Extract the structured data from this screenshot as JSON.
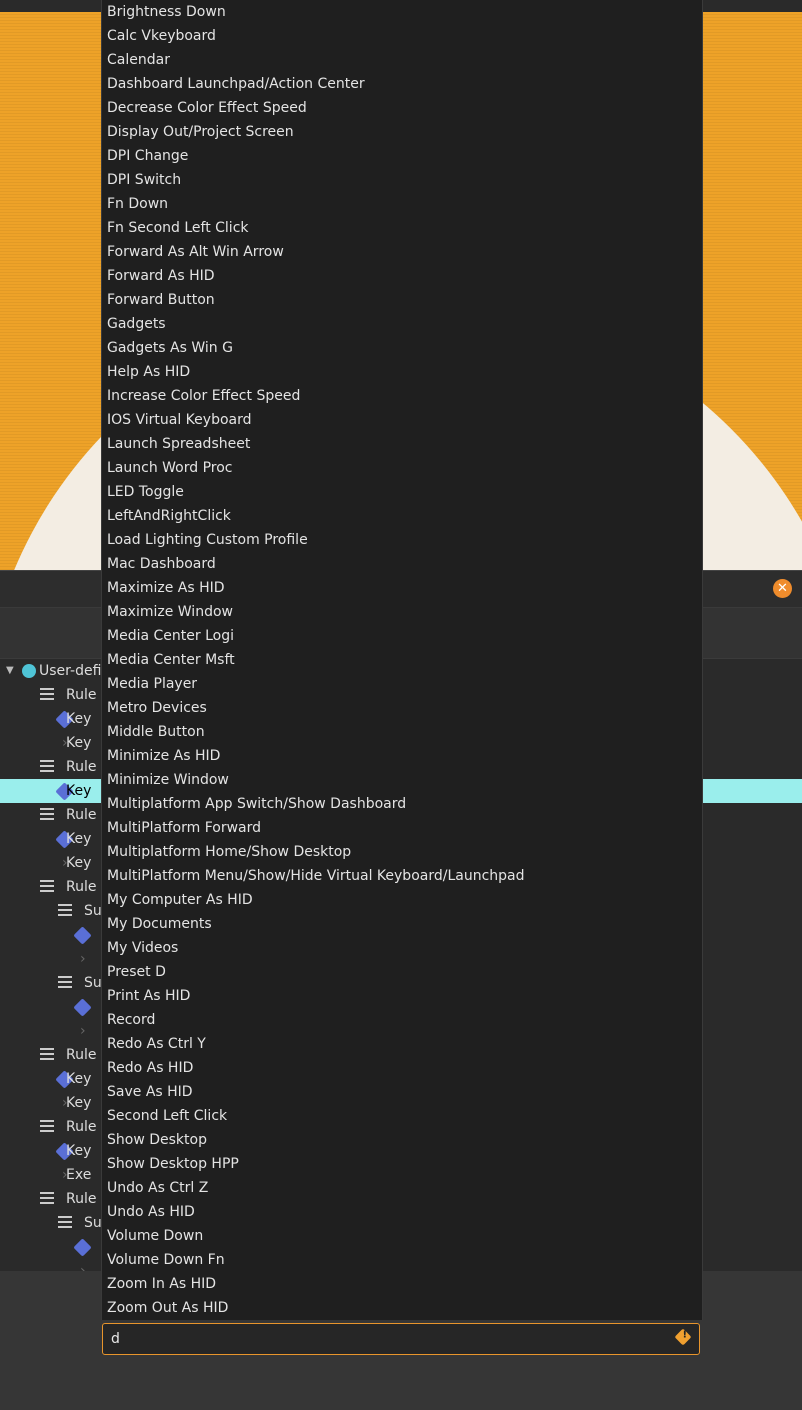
{
  "dropdown": {
    "items": [
      "Brightness Down",
      "Calc Vkeyboard",
      "Calendar",
      "Dashboard Launchpad/Action Center",
      "Decrease Color Effect Speed",
      "Display Out/Project Screen",
      "DPI Change",
      "DPI Switch",
      "Fn Down",
      "Fn Second Left Click",
      "Forward As Alt Win Arrow",
      "Forward As HID",
      "Forward Button",
      "Gadgets",
      "Gadgets As Win G",
      "Help As HID",
      "Increase Color Effect Speed",
      "IOS Virtual Keyboard",
      "Launch Spreadsheet",
      "Launch Word Proc",
      "LED Toggle",
      "LeftAndRightClick",
      "Load Lighting Custom Profile",
      "Mac Dashboard",
      "Maximize As HID",
      "Maximize Window",
      "Media Center Logi",
      "Media Center Msft",
      "Media Player",
      "Metro Devices",
      "Middle Button",
      "Minimize As HID",
      "Minimize Window",
      "Multiplatform App Switch/Show Dashboard",
      "MultiPlatform Forward",
      "Multiplatform Home/Show Desktop",
      "MultiPlatform Menu/Show/Hide Virtual Keyboard/Launchpad",
      "My Computer As HID",
      "My Documents",
      "My Videos",
      "Preset D",
      "Print As HID",
      "Record",
      "Redo As Ctrl Y",
      "Redo As HID",
      "Save As HID",
      "Second Left Click",
      "Show Desktop",
      "Show Desktop HPP",
      "Undo As Ctrl Z",
      "Undo As HID",
      "Volume Down",
      "Volume Down Fn",
      "Zoom In As HID",
      "Zoom Out As HID"
    ]
  },
  "search": {
    "value": "d",
    "icon": "warning-icon"
  },
  "window": {
    "close_icon": "close-icon",
    "close_glyph": "✕"
  },
  "tree": {
    "root_label": "User-defi",
    "rows": [
      {
        "label": "Rule",
        "icon": "list-icon"
      },
      {
        "label": "Key",
        "icon": "question-icon"
      },
      {
        "label": "Key",
        "icon": "chevron-right-icon"
      },
      {
        "label": "Rule",
        "icon": "list-icon"
      },
      {
        "label": "Key",
        "icon": "question-icon"
      },
      {
        "label": "Rule",
        "icon": "list-icon"
      },
      {
        "label": "Key",
        "icon": "question-icon"
      },
      {
        "label": "Key",
        "icon": "chevron-right-icon"
      },
      {
        "label": "Rule",
        "icon": "list-icon"
      },
      {
        "label": "Su",
        "icon": "list-icon"
      },
      {
        "label": "",
        "icon": "question-icon"
      },
      {
        "label": "",
        "icon": "chevron-right-icon"
      },
      {
        "label": "Su",
        "icon": "list-icon"
      },
      {
        "label": "",
        "icon": "question-icon"
      },
      {
        "label": "",
        "icon": "chevron-right-icon"
      },
      {
        "label": "Rule",
        "icon": "list-icon"
      },
      {
        "label": "Key",
        "icon": "question-icon"
      },
      {
        "label": "Key",
        "icon": "chevron-right-icon"
      },
      {
        "label": "Rule",
        "icon": "list-icon"
      },
      {
        "label": "Key",
        "icon": "question-icon"
      },
      {
        "label": "Exe",
        "icon": "chevron-right-icon"
      },
      {
        "label": "Rule",
        "icon": "list-icon"
      },
      {
        "label": "Su",
        "icon": "list-icon"
      },
      {
        "label": "",
        "icon": "question-icon"
      },
      {
        "label": "",
        "icon": "chevron-right-icon"
      }
    ]
  },
  "colors": {
    "accent": "#e8952c",
    "selection": "#9aeeec",
    "dropdown_bg": "#1f1f1f"
  }
}
